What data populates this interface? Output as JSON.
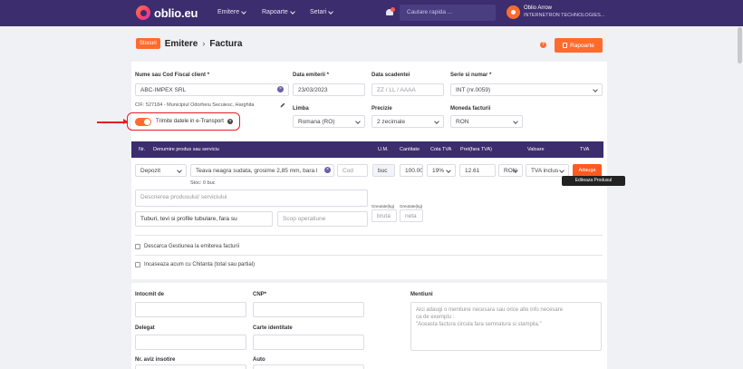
{
  "nav": {
    "brand": "oblio.eu",
    "menu": [
      {
        "label": "Emitere"
      },
      {
        "label": "Rapoarte"
      },
      {
        "label": "Setari"
      }
    ],
    "search_placeholder": "Cautare rapida ...",
    "user_name": "Oblio Arrow",
    "user_company": "INTERNETRON TECHNOLOGIES..."
  },
  "header": {
    "stocuri": "Stocuri",
    "crumb1": "Emitere",
    "crumb2": "Factura",
    "sep": "›",
    "rapoarte": "Rapoarte"
  },
  "form": {
    "client_label": "Nume sau Cod Fiscal client *",
    "client_value": "ABC-IMPEX SRL",
    "client_cif": "CIF: 527184 - Municipiul Odorheiu Secuiesc, Harghita",
    "data_emitere_label": "Data emiterii *",
    "data_emitere_value": "23/03/2023",
    "data_scadenta_label": "Data scadentei",
    "data_scadenta_ph": "ZZ / LL / AAAA",
    "serie_label": "Serie si numar *",
    "serie_value": "INT (nr.0059)",
    "limba_label": "Limba",
    "limba_value": "Romana (RO)",
    "precizie_label": "Precizie",
    "precizie_value": "2 zecimale",
    "moneda_label": "Moneda facturii",
    "moneda_value": "RON",
    "etransport_label": "Trimite datele in e-Transport",
    "etransport_on": true
  },
  "table": {
    "headers": [
      "Nr.",
      "Denumire produs sau serviciu",
      "U.M.",
      "Cantitate",
      "Cota TVA",
      "Pret(fara TVA)",
      "Valoare",
      "TVA"
    ],
    "row": {
      "tip": "Depozit",
      "produs": "Teava neagra sudata, grosime 2,85 mm, bara l",
      "cod_ph": "Cod",
      "stoc": "Stoc: 0 buc",
      "um": "buc",
      "cantitate": "100.00",
      "cota": "19%",
      "pret": "12.61",
      "moneda": "RON",
      "tva_mode": "TVA inclus",
      "descriere_ph": "Descrierea produsului/ serviciului",
      "categorie": "Tuburi, tevi si profile tubulare, fara su",
      "scop_ph": "Scop operatiune",
      "greutate_bruta_label": "Greutate(kg)",
      "greutate_bruta_ph": "bruta",
      "greutate_neta_label": "Greutate(kg)",
      "greutate_neta_ph": "neta"
    },
    "add_button": "Adauga",
    "tooltip": "Editeaza Produsul"
  },
  "options": {
    "descarca": "Descarca Gestiunea la emiterea facturii",
    "incaseaza": "Incaseaza acum cu Chitanta (total sau partial)"
  },
  "footer": {
    "intocmit_label": "Intocmit de",
    "cnp_label": "CNP*",
    "delegat_label": "Delegat",
    "carte_label": "Carte identitate",
    "aviz_label": "Nr. aviz insotire",
    "auto_label": "Auto",
    "mentiuni_label": "Mentiuni",
    "mentiuni_ph_1": "Aici adaugi o mentiune necesara sau orice alte info necesare",
    "mentiuni_ph_2": "ca de exemplu :",
    "mentiuni_ph_3": "\"Aceasta factura circula fara semnatura si stampila.\""
  }
}
